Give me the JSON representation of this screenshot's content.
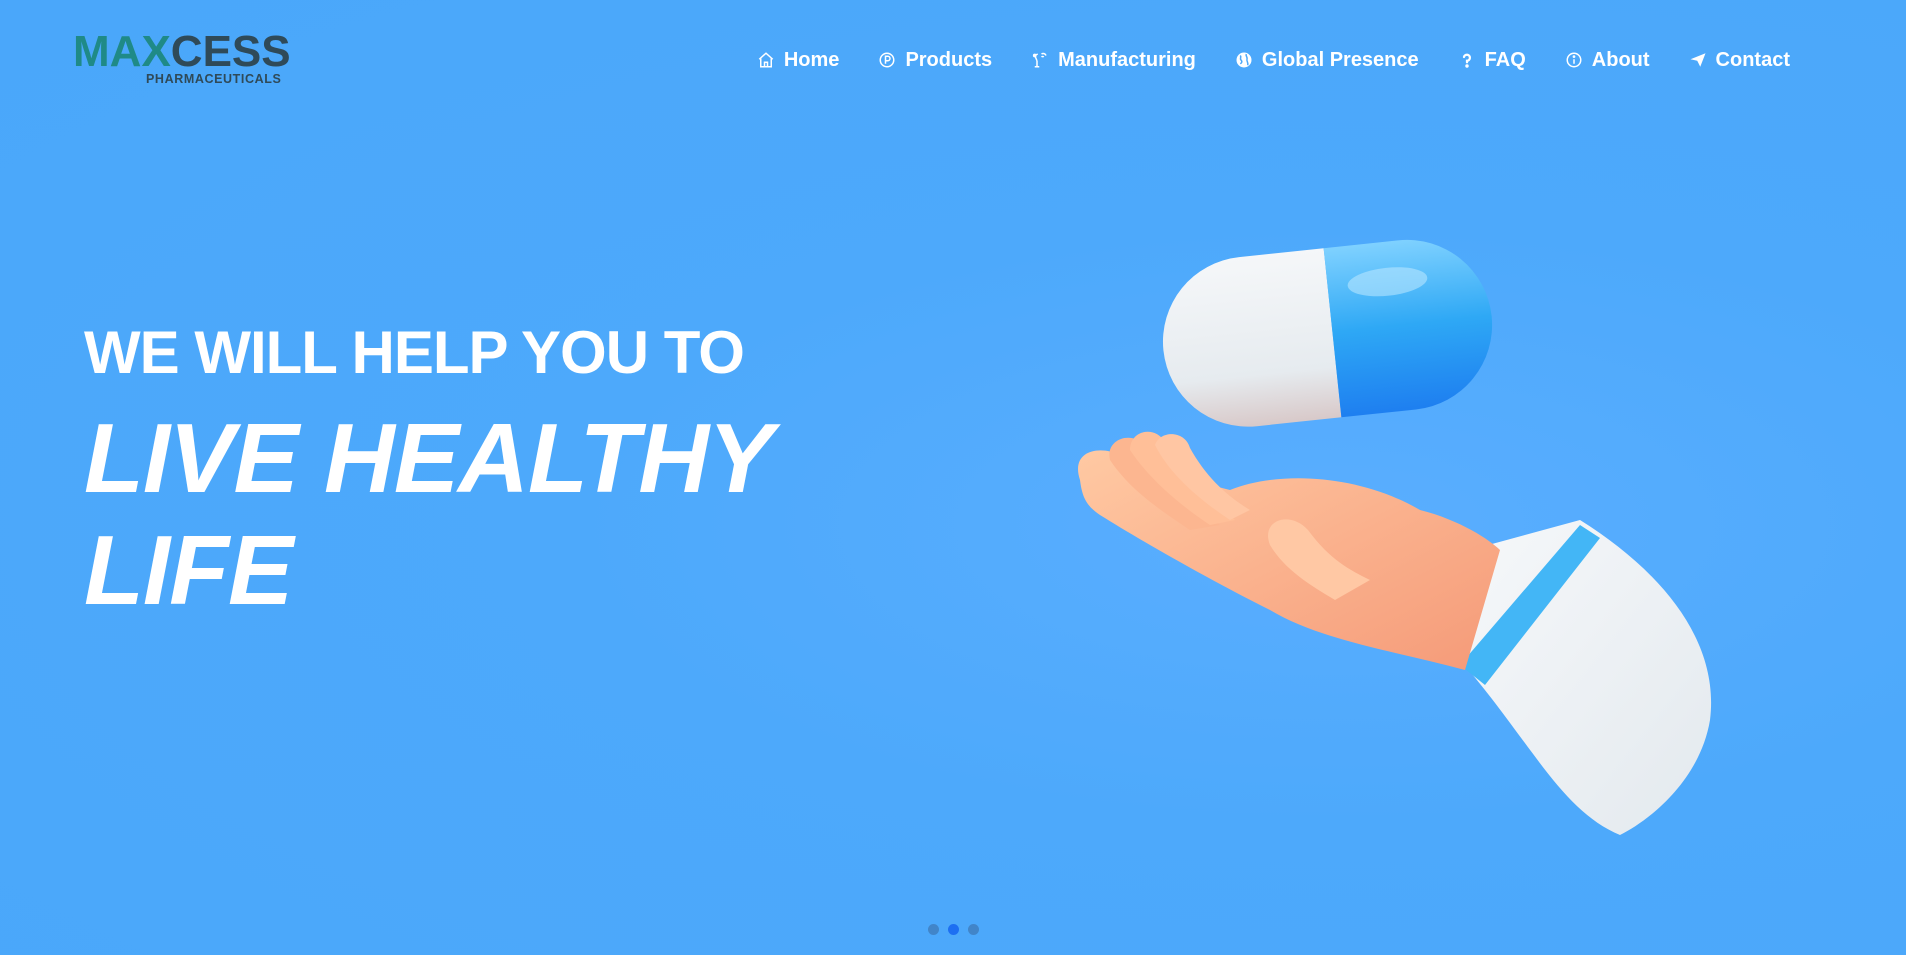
{
  "logo": {
    "main_part_1": "MA",
    "main_part_2": "X",
    "main_part_3": "CESS",
    "sub": "PHARMACEUTICALS"
  },
  "nav": {
    "items": [
      {
        "label": "Home",
        "icon": "home-icon"
      },
      {
        "label": "Products",
        "icon": "product-icon"
      },
      {
        "label": "Manufacturing",
        "icon": "manufacturing-icon"
      },
      {
        "label": "Global Presence",
        "icon": "globe-icon"
      },
      {
        "label": "FAQ",
        "icon": "question-icon"
      },
      {
        "label": "About",
        "icon": "info-icon"
      },
      {
        "label": "Contact",
        "icon": "send-icon"
      }
    ]
  },
  "hero": {
    "line1": "WE WILL HELP YOU TO",
    "line2": "LIVE HEALTHY LIFE",
    "slides": {
      "count": 3,
      "active_index": 1
    }
  },
  "colors": {
    "background": "#4da9fb",
    "text": "#ffffff",
    "logo_teal": "#1f8a87",
    "logo_dark": "#2f4a58",
    "dot_active": "#1d6ff2"
  }
}
